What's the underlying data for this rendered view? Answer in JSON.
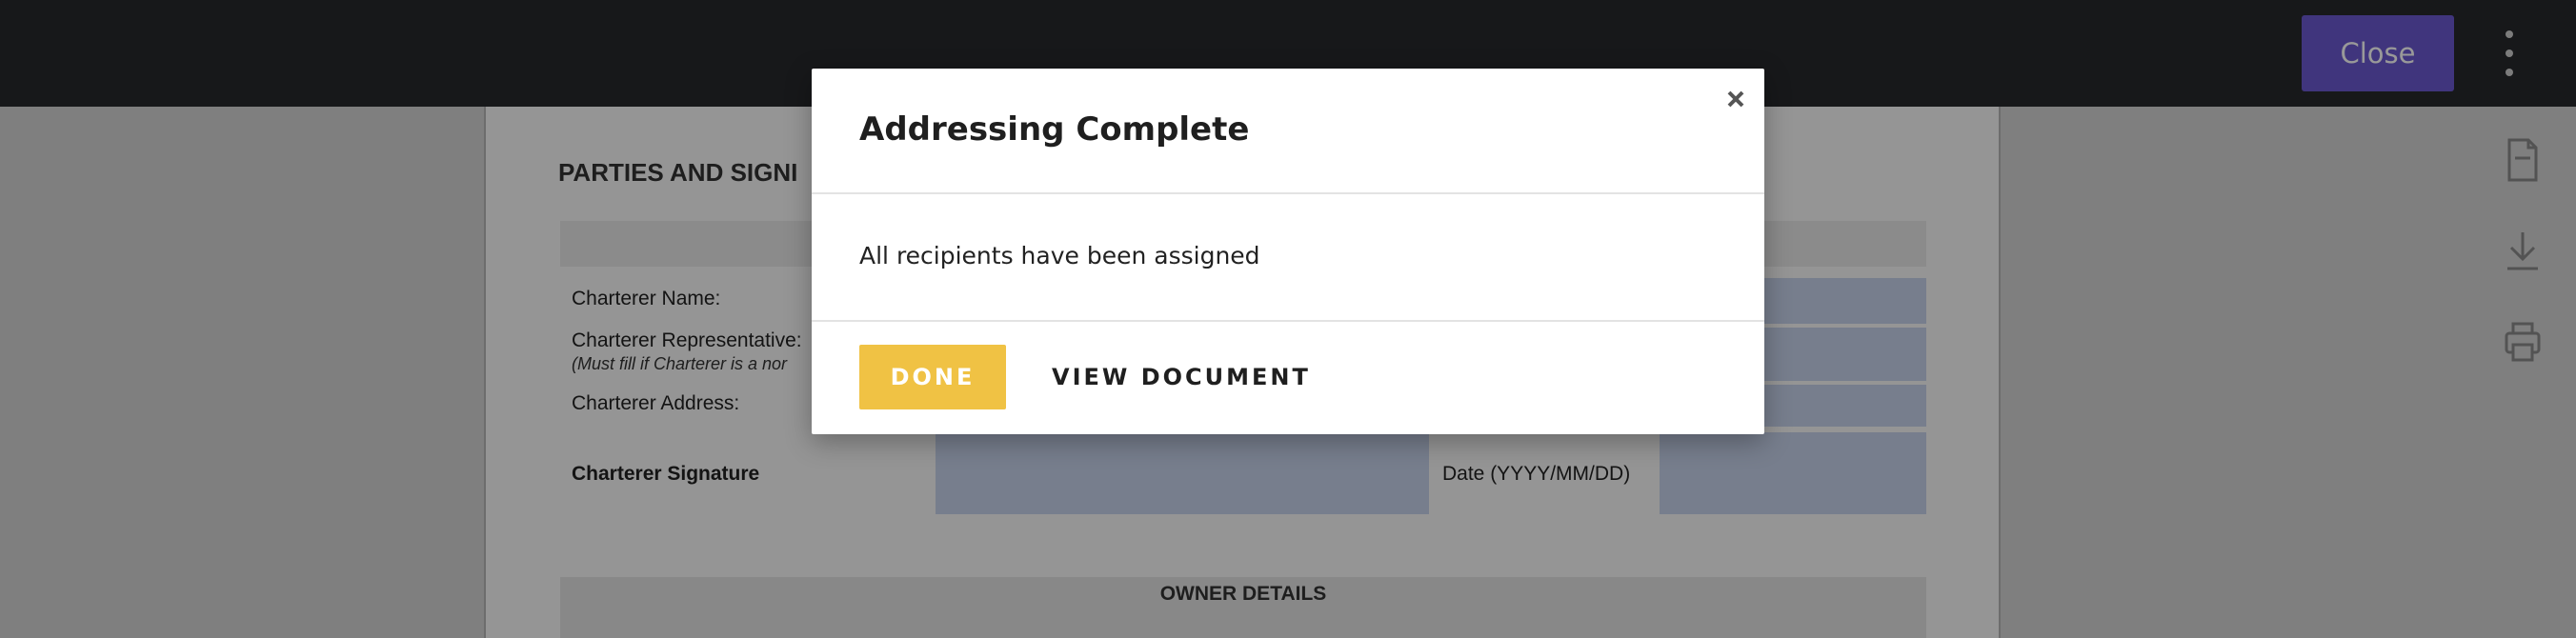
{
  "toolbar": {
    "close_label": "Close",
    "more_icon": "kebab-menu-icon"
  },
  "side_tools": [
    {
      "icon": "document-icon"
    },
    {
      "icon": "download-icon"
    },
    {
      "icon": "print-icon"
    }
  ],
  "document": {
    "section_heading": "PARTIES AND SIGNI",
    "rows": {
      "charterer_name": "Charterer Name:",
      "charterer_rep": "Charterer Representative:",
      "charterer_rep_note": "(Must fill if Charterer is a nor",
      "charterer_address": "Charterer Address:",
      "charterer_signature": "Charterer Signature",
      "date_label": "Date (YYYY/MM/DD)"
    },
    "owner_details": "OWNER DETAILS"
  },
  "modal": {
    "title": "Addressing Complete",
    "message": "All recipients have been assigned",
    "done_label": "DONE",
    "view_label": "VIEW DOCUMENT",
    "close_icon": "close-icon"
  },
  "colors": {
    "topbar": "#27282c",
    "close_button": "#6b59d0",
    "done_button": "#f0c244",
    "field_fill": "#c7d2ec",
    "overlay": "rgba(0,0,0,0.4)"
  }
}
